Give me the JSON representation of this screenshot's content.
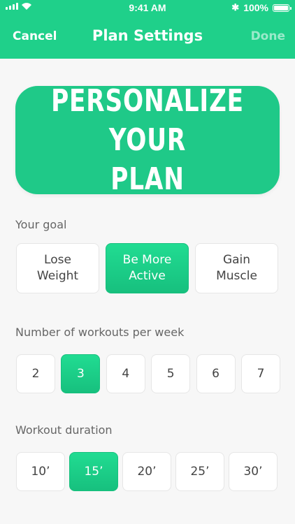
{
  "status_bar": {
    "time": "9:41 AM",
    "battery": "100%",
    "bluetooth_icon": "bluetooth-icon",
    "signal_icon": "signal-icon",
    "wifi_icon": "wifi-icon",
    "battery_icon": "battery-icon",
    "battery_level": 1.0
  },
  "nav": {
    "cancel": "Cancel",
    "title": "Plan Settings",
    "done": "Done"
  },
  "hero": {
    "text": "PERSONALIZE YOUR\nPLAN"
  },
  "goal": {
    "label": "Your goal",
    "options": [
      "Lose\nWeight",
      "Be More\nActive",
      "Gain\nMuscle"
    ],
    "selected": "Be More\nActive"
  },
  "workouts": {
    "label": "Number of workouts per week",
    "options": [
      "2",
      "3",
      "4",
      "5",
      "6",
      "7"
    ],
    "selected": "3"
  },
  "duration": {
    "label": "Workout duration",
    "options": [
      "10’",
      "15’",
      "20’",
      "25’",
      "30’"
    ],
    "selected": "15’"
  },
  "colors": {
    "accent": "#1fd08a",
    "selected_bg": "#17c07e",
    "label_text": "#666666"
  }
}
